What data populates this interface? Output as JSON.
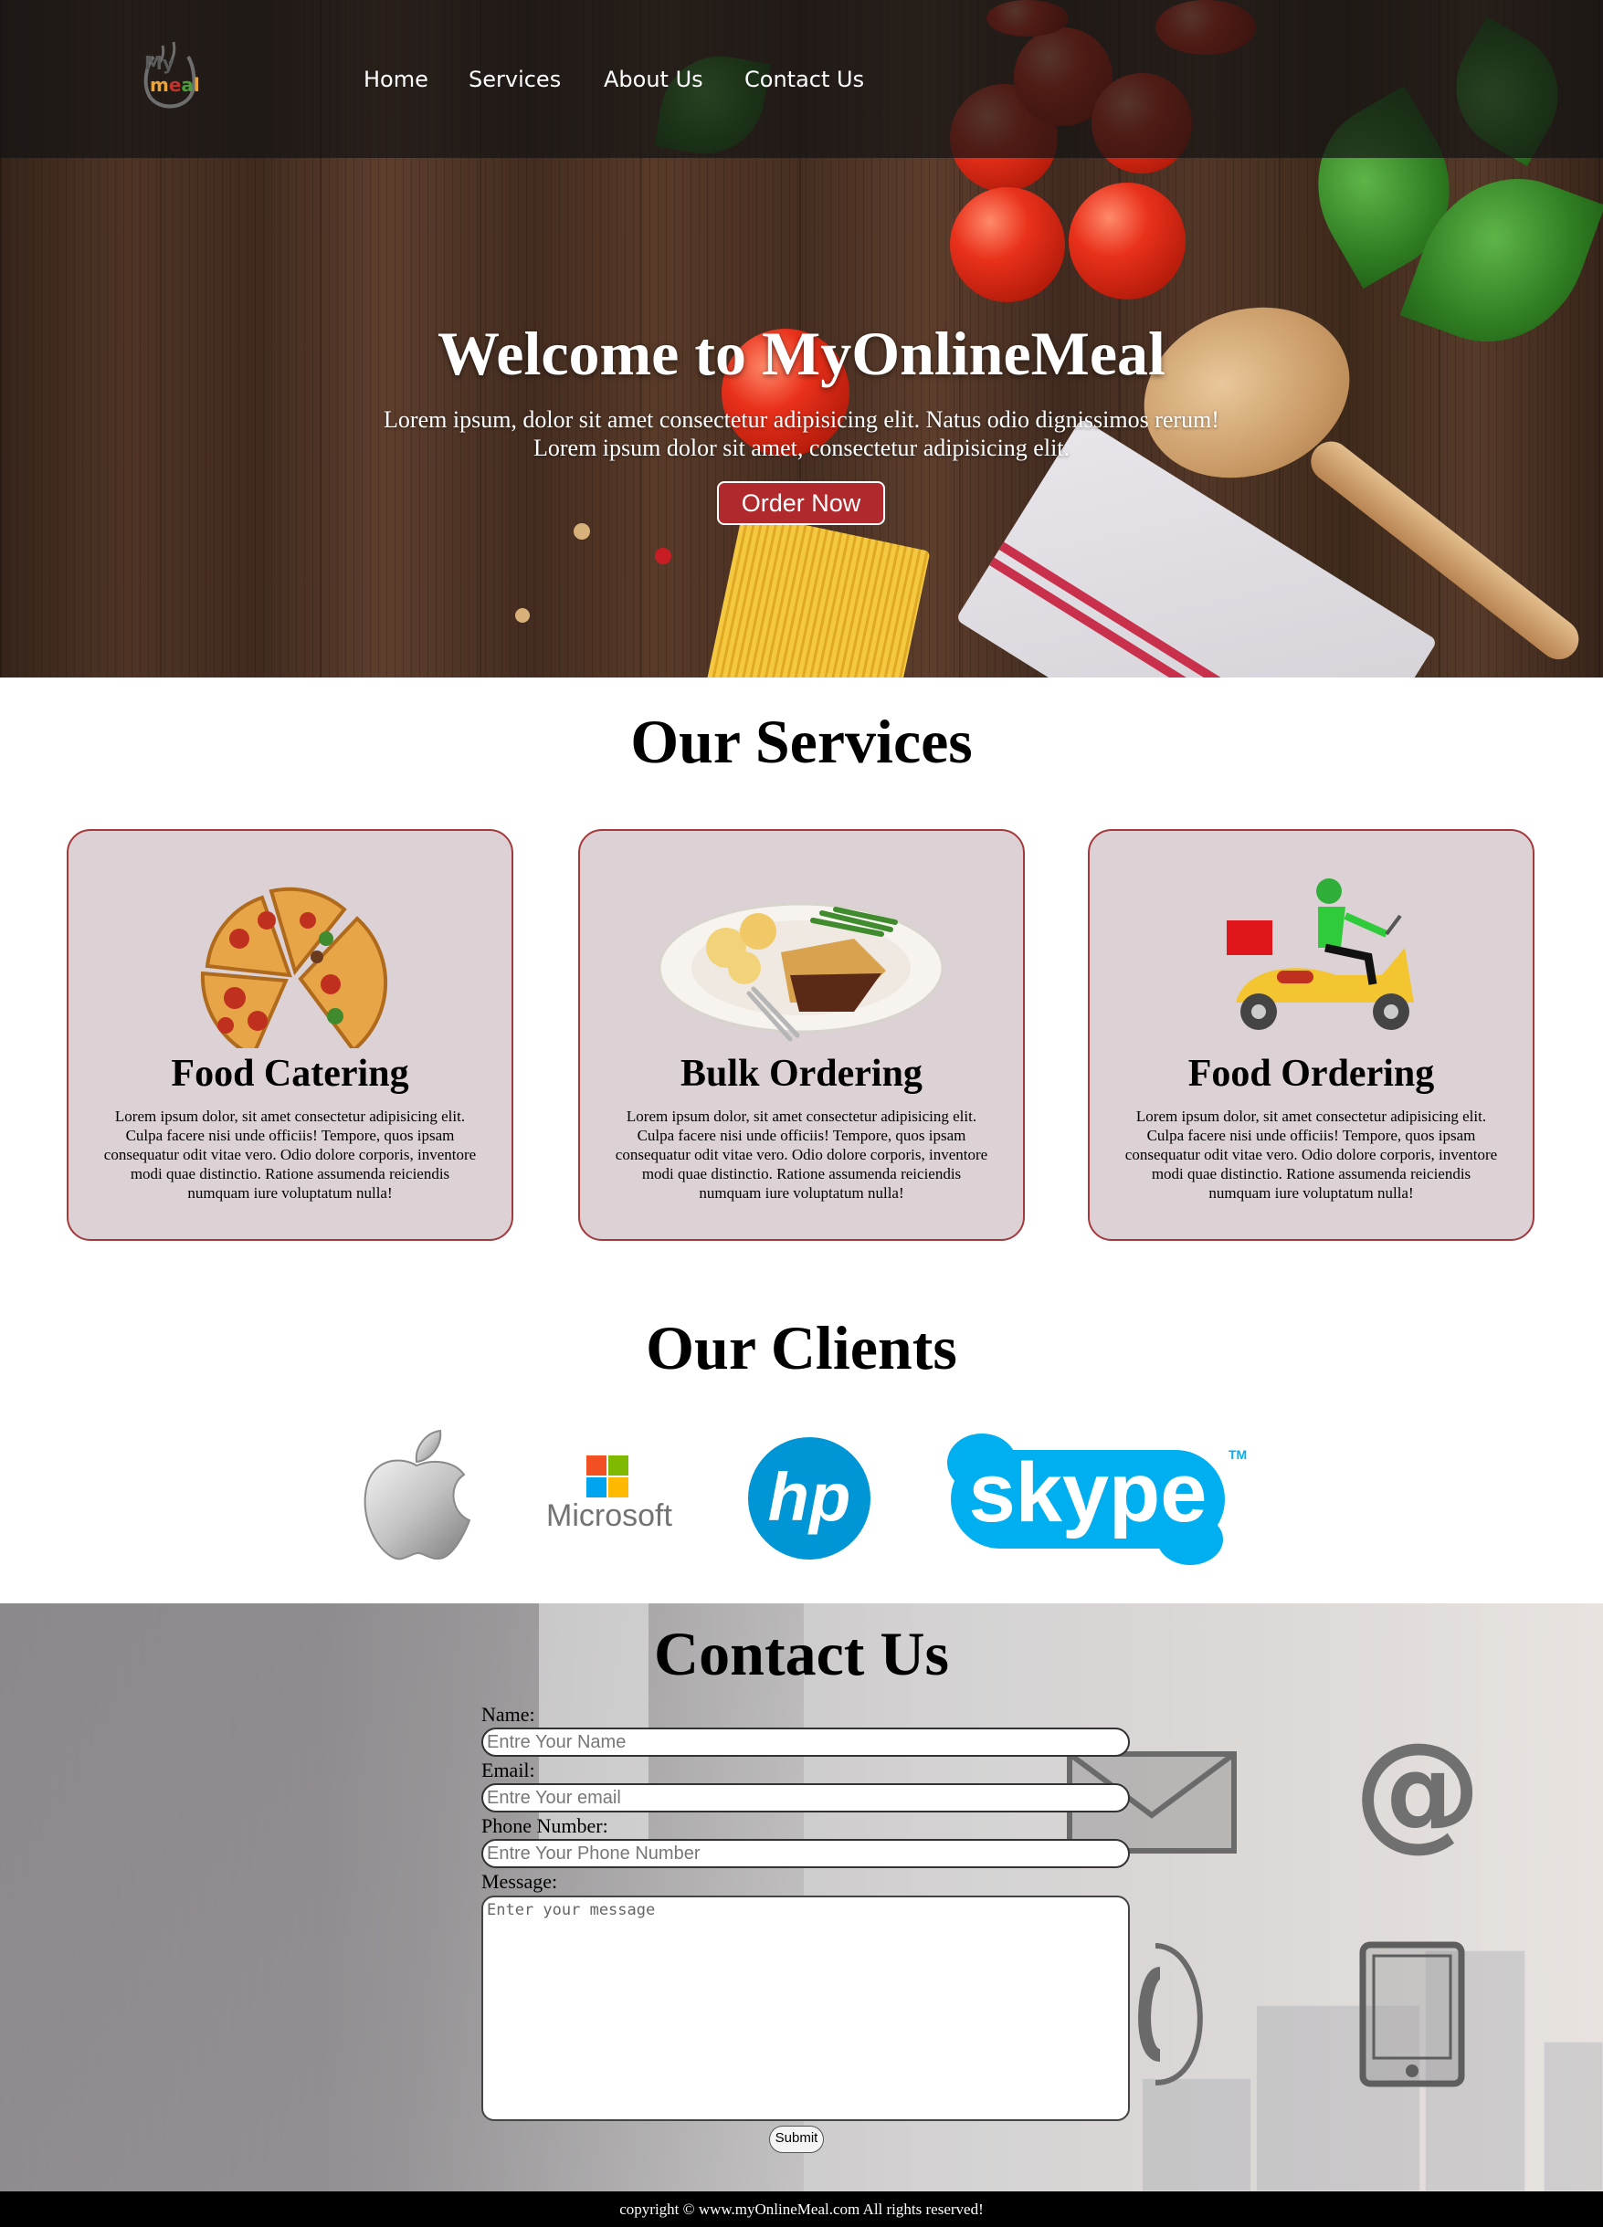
{
  "nav": {
    "logo_text": "My meal",
    "links": [
      "Home",
      "Services",
      "About Us",
      "Contact Us"
    ]
  },
  "hero": {
    "title": "Welcome to MyOnlineMeal",
    "subtitle_line1": "Lorem ipsum, dolor sit amet consectetur adipisicing elit. Natus odio dignissimos rerum!",
    "subtitle_line2": "Lorem ipsum dolor sit amet, consectetur adipisicing elit.",
    "button_label": "Order Now"
  },
  "services": {
    "title": "Our Services",
    "cards": [
      {
        "title": "Food Catering",
        "icon": "pizza-icon",
        "text": "Lorem ipsum dolor, sit amet consectetur adipisicing elit. Culpa facere nisi unde officiis! Tempore, quos ipsam consequatur odit vitae vero. Odio dolore corporis, inventore modi quae distinctio. Ratione assumenda reiciendis numquam iure voluptatum nulla!"
      },
      {
        "title": "Bulk Ordering",
        "icon": "meal-plate-icon",
        "text": "Lorem ipsum dolor, sit amet consectetur adipisicing elit. Culpa facere nisi unde officiis! Tempore, quos ipsam consequatur odit vitae vero. Odio dolore corporis, inventore modi quae distinctio. Ratione assumenda reiciendis numquam iure voluptatum nulla!"
      },
      {
        "title": "Food Ordering",
        "icon": "delivery-scooter-icon",
        "text": "Lorem ipsum dolor, sit amet consectetur adipisicing elit. Culpa facere nisi unde officiis! Tempore, quos ipsam consequatur odit vitae vero. Odio dolore corporis, inventore modi quae distinctio. Ratione assumenda reiciendis numquam iure voluptatum nulla!"
      }
    ]
  },
  "clients": {
    "title": "Our Clients",
    "logos": [
      "apple-logo",
      "Microsoft",
      "hp",
      "skype"
    ]
  },
  "contact": {
    "title": "Contact Us",
    "name_label": "Name:",
    "name_placeholder": "Entre Your Name",
    "email_label": "Email:",
    "email_placeholder": "Entre Your email",
    "phone_label": "Phone Number:",
    "phone_placeholder": "Entre Your Phone Number",
    "message_label": "Message:",
    "message_placeholder": "Enter your message",
    "submit_label": "Submit"
  },
  "footer": {
    "text": "copyright © www.myOnlineMeal.com All rights reserved!"
  },
  "colors": {
    "accent": "#b02a2d",
    "card_bg": "#dcd1d5",
    "card_border": "#a33a3e",
    "nav_bg": "#141414",
    "footer_bg": "#000000"
  }
}
